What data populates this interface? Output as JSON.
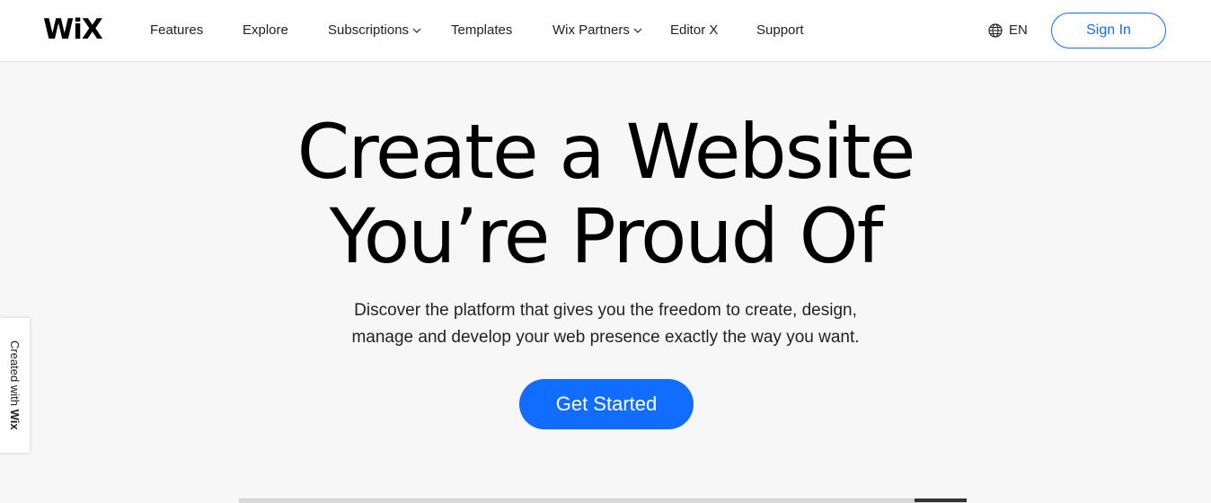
{
  "header": {
    "logo": "WiX",
    "nav": [
      {
        "label": "Features",
        "has_dropdown": false
      },
      {
        "label": "Explore",
        "has_dropdown": false
      },
      {
        "label": "Subscriptions",
        "has_dropdown": true
      },
      {
        "label": "Templates",
        "has_dropdown": false
      },
      {
        "label": "Wix Partners",
        "has_dropdown": true
      },
      {
        "label": "Editor X",
        "has_dropdown": false
      },
      {
        "label": "Support",
        "has_dropdown": false
      }
    ],
    "language": {
      "icon": "globe-icon",
      "label": "EN"
    },
    "sign_in_label": "Sign In"
  },
  "hero": {
    "title_line1": "Create a Website",
    "title_line2": "You’re Proud Of",
    "subtitle_line1": "Discover the platform that gives you the freedom to create, design,",
    "subtitle_line2": "manage and develop your web presence exactly the way you want.",
    "cta_label": "Get Started"
  },
  "side_badge": {
    "prefix": "Created with ",
    "brand": "Wix"
  },
  "colors": {
    "accent": "#116dff",
    "page_background": "#f7f7f7",
    "header_background": "#ffffff"
  }
}
